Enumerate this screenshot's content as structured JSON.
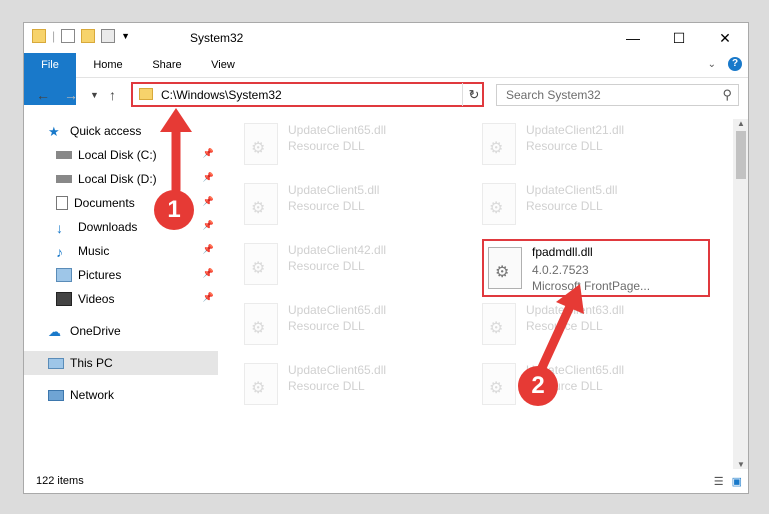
{
  "window": {
    "title": "System32",
    "controls": {
      "minimize": "—",
      "maximize": "☐",
      "close": "✕"
    }
  },
  "ribbon": {
    "tabs": [
      "File",
      "Home",
      "Share",
      "View"
    ],
    "help": "?"
  },
  "address": {
    "path": "C:\\Windows\\System32",
    "search_placeholder": "Search System32"
  },
  "sidebar": {
    "items": [
      {
        "label": "Quick access",
        "icon": "star-icon",
        "pinned": false
      },
      {
        "label": "Local Disk (C:)",
        "icon": "drive-icon",
        "pinned": true
      },
      {
        "label": "Local Disk (D:)",
        "icon": "drive-icon",
        "pinned": true
      },
      {
        "label": "Documents",
        "icon": "documents-icon",
        "pinned": true
      },
      {
        "label": "Downloads",
        "icon": "download-icon",
        "pinned": true
      },
      {
        "label": "Music",
        "icon": "music-icon",
        "pinned": true
      },
      {
        "label": "Pictures",
        "icon": "pictures-icon",
        "pinned": true
      },
      {
        "label": "Videos",
        "icon": "videos-icon",
        "pinned": true
      },
      {
        "label": "OneDrive",
        "icon": "cloud-icon",
        "pinned": false
      },
      {
        "label": "This PC",
        "icon": "computer-icon",
        "pinned": false,
        "selected": true
      },
      {
        "label": "Network",
        "icon": "network-icon",
        "pinned": false
      }
    ]
  },
  "files": [
    {
      "name": "UpdateClient65.dll",
      "sub": "Resource DLL"
    },
    {
      "name": "UpdateClient21.dll",
      "sub": "Resource DLL"
    },
    {
      "name": "UpdateClient5.dll",
      "sub": "Resource DLL"
    },
    {
      "name": "UpdateClient5.dll",
      "sub": "Resource DLL"
    },
    {
      "name": "UpdateClient42.dll",
      "sub": "Resource DLL"
    },
    {
      "name": "UpdateClient65.dll",
      "sub": "Resource DLL"
    },
    {
      "name": "UpdateClient63.dll",
      "sub": "Resource DLL"
    },
    {
      "name": "UpdateClient65.dll",
      "sub": "Resource DLL"
    },
    {
      "name": "UpdateClient65.dll",
      "sub": "Resource DLL"
    }
  ],
  "highlighted_file": {
    "name": "fpadmdll.dll",
    "version": "4.0.2.7523",
    "description": "Microsoft FrontPage..."
  },
  "status": {
    "count": "122 items"
  },
  "callouts": [
    "1",
    "2"
  ],
  "colors": {
    "accent": "#1979ca",
    "highlight": "#e0393e",
    "callout": "#e63a35"
  }
}
